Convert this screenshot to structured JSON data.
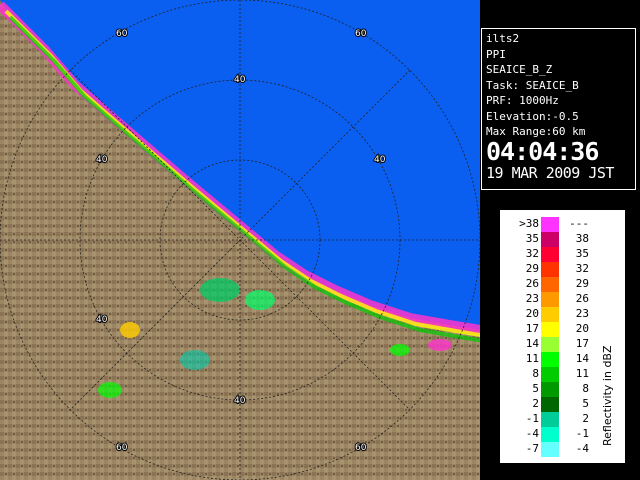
{
  "info": {
    "station": "ilts2",
    "mode": "PPI",
    "product": "SEAICE_B_Z",
    "task": "Task: SEAICE_B",
    "prf": "PRF: 1000Hz",
    "elevation": "Elevation:-0.5",
    "max_range": "Max Range:60 km",
    "time": "04:04:36",
    "date": "19 MAR 2009 JST"
  },
  "legend": {
    "label": "Reflectivity in dBZ",
    "rows": [
      {
        "lo": ">38",
        "hi": "---",
        "color": "#ff33ff"
      },
      {
        "lo": "35",
        "hi": "38",
        "color": "#cc0066"
      },
      {
        "lo": "32",
        "hi": "35",
        "color": "#ff0033"
      },
      {
        "lo": "29",
        "hi": "32",
        "color": "#ff3300"
      },
      {
        "lo": "26",
        "hi": "29",
        "color": "#ff6600"
      },
      {
        "lo": "23",
        "hi": "26",
        "color": "#ff9900"
      },
      {
        "lo": "20",
        "hi": "23",
        "color": "#ffcc00"
      },
      {
        "lo": "17",
        "hi": "20",
        "color": "#ffff00"
      },
      {
        "lo": "14",
        "hi": "17",
        "color": "#99ff33"
      },
      {
        "lo": "11",
        "hi": "14",
        "color": "#00ff00"
      },
      {
        "lo": "8",
        "hi": "11",
        "color": "#00cc00"
      },
      {
        "lo": "5",
        "hi": "8",
        "color": "#009900"
      },
      {
        "lo": "2",
        "hi": "5",
        "color": "#006600"
      },
      {
        "lo": "-1",
        "hi": "2",
        "color": "#00cc99"
      },
      {
        "lo": "-4",
        "hi": "-1",
        "color": "#00ffcc"
      },
      {
        "lo": "-7",
        "hi": "-4",
        "color": "#66ffff"
      }
    ]
  },
  "map": {
    "range_labels": [
      "60",
      "60",
      "40",
      "40",
      "40",
      "40",
      "40",
      "60",
      "60"
    ],
    "colors": {
      "sea": "#0a5ef0",
      "land": "#9b8563",
      "ring": "#222222",
      "coast_echo": "#ff33cc"
    }
  }
}
